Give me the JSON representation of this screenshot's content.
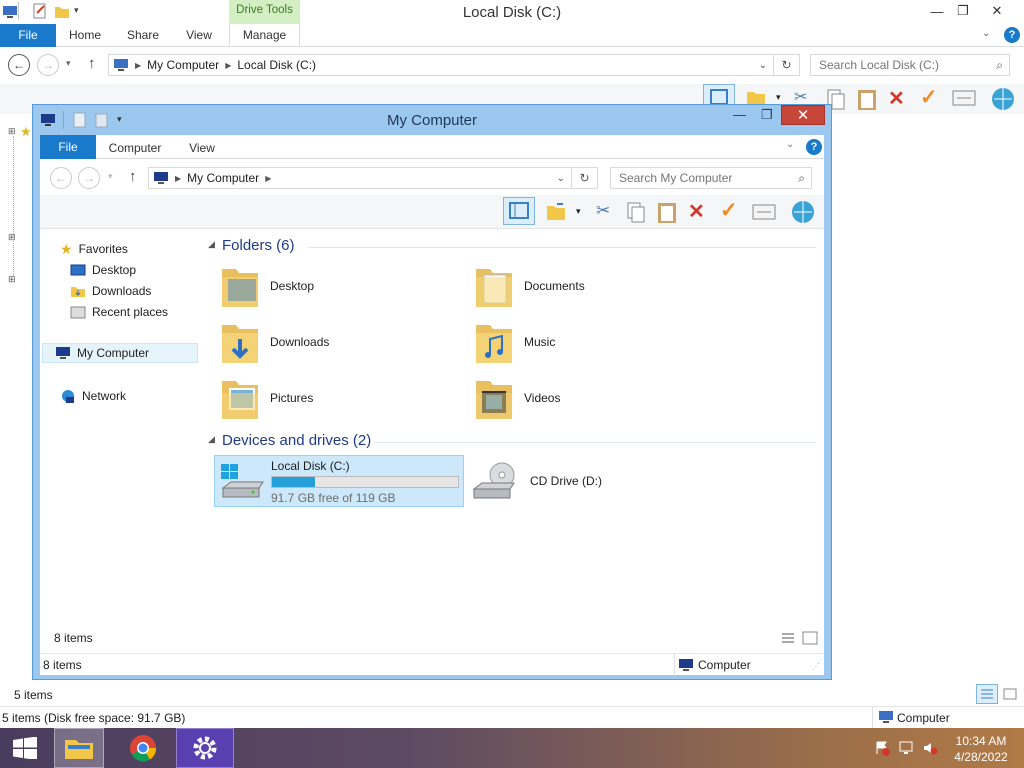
{
  "back_window": {
    "title": "Local Disk (C:)",
    "context_tab": "Drive Tools",
    "tabs": [
      "File",
      "Home",
      "Share",
      "View",
      "Manage"
    ],
    "address": [
      "My Computer",
      "Local Disk (C:)"
    ],
    "search_placeholder": "Search Local Disk (C:)",
    "items_count": "5 items",
    "status_text": "5 items (Disk free space: 91.7 GB)",
    "status_location": "Computer"
  },
  "front_window": {
    "title": "My Computer",
    "tabs": [
      "File",
      "Computer",
      "View"
    ],
    "address": [
      "My Computer"
    ],
    "search_placeholder": "Search My Computer",
    "nav_pane": {
      "favorites_label": "Favorites",
      "favorites": [
        "Desktop",
        "Downloads",
        "Recent places"
      ],
      "my_computer": "My Computer",
      "network": "Network"
    },
    "folders_header": "Folders (6)",
    "folders": [
      "Desktop",
      "Documents",
      "Downloads",
      "Music",
      "Pictures",
      "Videos"
    ],
    "devices_header": "Devices and drives (2)",
    "drive_c": {
      "name": "Local Disk (C:)",
      "free_text": "91.7 GB free of 119 GB",
      "used_fraction": 0.23
    },
    "drive_d": {
      "name": "CD Drive (D:)"
    },
    "items_count_inner": "8 items",
    "status_text": "8 items",
    "status_location": "Computer"
  },
  "taskbar": {
    "time": "10:34 AM",
    "date": "4/28/2022"
  }
}
